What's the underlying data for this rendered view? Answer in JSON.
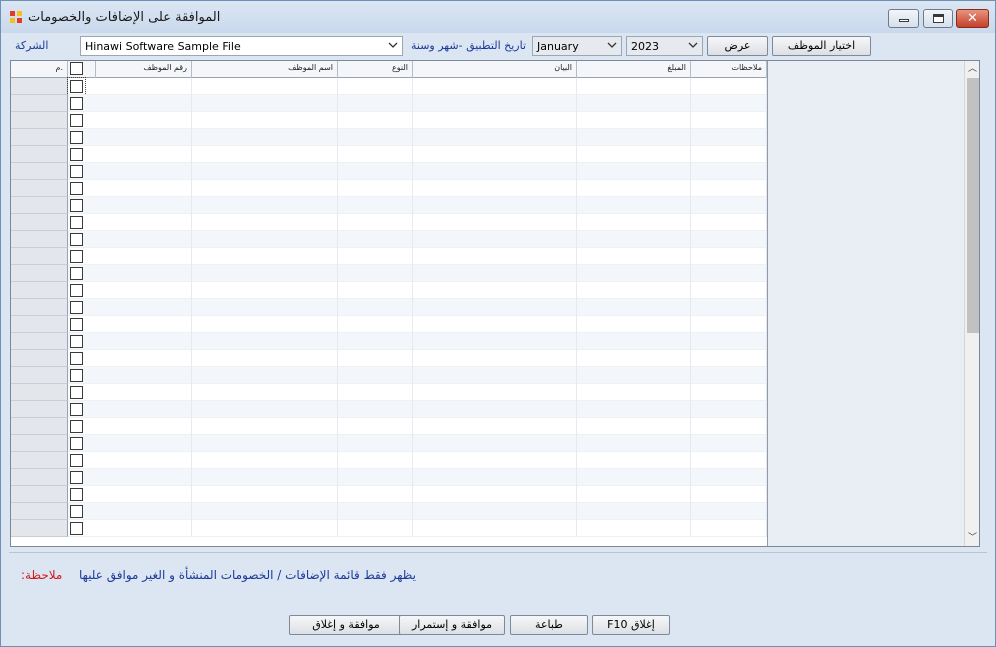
{
  "window": {
    "title": "الموافقة على الإضافات والخصومات",
    "colors": {
      "frame": "#dbe6f2",
      "accent_label": "#1a3a9a",
      "note_red": "#d11a1a",
      "close_button": "#c4402a"
    }
  },
  "toolbar": {
    "company_label": "الشركة",
    "company_value": "Hinawi Software Sample File",
    "date_label": "تاريخ التطبيق -شهر وسنة",
    "month_value": "January",
    "year_value": "2023",
    "view_button": "عرض",
    "employee_button": "اختيار الموظف"
  },
  "grid": {
    "columns": [
      {
        "key": "num",
        "label": "م."
      },
      {
        "key": "check",
        "label": ""
      },
      {
        "key": "employee_number",
        "label": "رقم الموظف"
      },
      {
        "key": "employee_name",
        "label": "اسم الموظف"
      },
      {
        "key": "type",
        "label": "النوع"
      },
      {
        "key": "description",
        "label": "البيان"
      },
      {
        "key": "amount",
        "label": "المبلغ"
      },
      {
        "key": "notes",
        "label": "ملاحظات"
      }
    ],
    "rows": []
  },
  "note": {
    "label": ":ملاحظة",
    "text": "يظهر فقط قائمة الإضافات / الخصومات المنشأة و الغير موافق عليها"
  },
  "buttons": {
    "approve_close": "موافقة و إغلاق",
    "approve_continue": "موافقة و  إستمرار",
    "print": "طباعة",
    "close": "F10 إغلاق"
  }
}
